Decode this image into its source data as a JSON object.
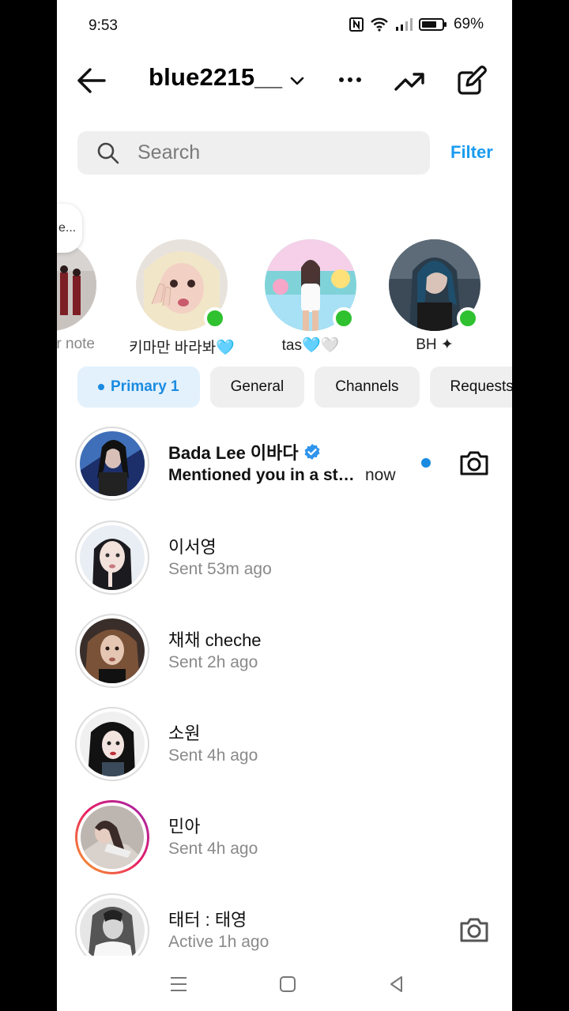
{
  "status": {
    "time": "9:53",
    "battery": "69%"
  },
  "header": {
    "username": "blue2215__"
  },
  "search": {
    "placeholder": "Search",
    "filter_label": "Filter"
  },
  "notes": {
    "bubble_text": "e...",
    "items": [
      {
        "label": "r note",
        "online": false
      },
      {
        "label": "키마만 바라봐🩵",
        "online": true
      },
      {
        "label": "tas🩵🤍",
        "online": true
      },
      {
        "label": "BH ✦",
        "online": true
      }
    ]
  },
  "tabs": [
    {
      "label": "Primary 1",
      "active": true
    },
    {
      "label": "General"
    },
    {
      "label": "Channels"
    },
    {
      "label": "Requests"
    }
  ],
  "chats": [
    {
      "name": "Bada Lee 이바다",
      "verified": true,
      "subtitle": "Mentioned you in a st…",
      "time": "now",
      "unread": true
    },
    {
      "name": "이서영",
      "subtitle": "Sent 53m ago"
    },
    {
      "name": "채채 cheche",
      "subtitle": "Sent 2h ago"
    },
    {
      "name": "소원",
      "subtitle": "Sent 4h ago"
    },
    {
      "name": "민아",
      "subtitle": "Sent 4h ago",
      "story_ring": true
    },
    {
      "name": "태터 : 태영",
      "subtitle": "Active 1h ago"
    }
  ],
  "colors": {
    "accent": "#1a9cf0",
    "online": "#2fc12f",
    "tab_active_bg": "#e3f1fd"
  }
}
